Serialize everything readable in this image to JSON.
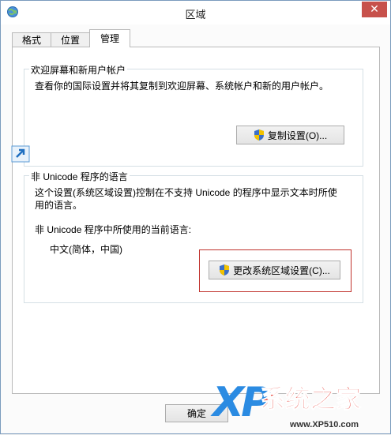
{
  "window": {
    "title": "区域",
    "close_glyph": "✕",
    "title_icon": "globe-icon"
  },
  "tabs": [
    {
      "label": "格式",
      "active": false
    },
    {
      "label": "位置",
      "active": false
    },
    {
      "label": "管理",
      "active": true
    }
  ],
  "welcome_group": {
    "legend": "欢迎屏幕和新用户帐户",
    "description": "查看你的国际设置并将其复制到欢迎屏幕、系统帐户和新的用户帐户。",
    "copy_button": "复制设置(O)...",
    "button_icon": "uac-shield-icon"
  },
  "unicode_group": {
    "legend": "非 Unicode 程序的语言",
    "description_line1": "这个设置(系统区域设置)控制在不支持 Unicode 的程序中显示文本时所使",
    "description_line2": "用的语言。",
    "current_label": "非 Unicode 程序中所使用的当前语言:",
    "current_value": "中文(简体，中国)",
    "change_button": "更改系统区域设置(C)...",
    "button_icon": "uac-shield-icon"
  },
  "footer": {
    "ok_button": "确定"
  },
  "watermark": {
    "logo_text": "XP",
    "brand": "系统之家",
    "url": "www.XP510.com"
  },
  "colors": {
    "highlight": "#c0312b",
    "close_button": "#c7514b"
  }
}
